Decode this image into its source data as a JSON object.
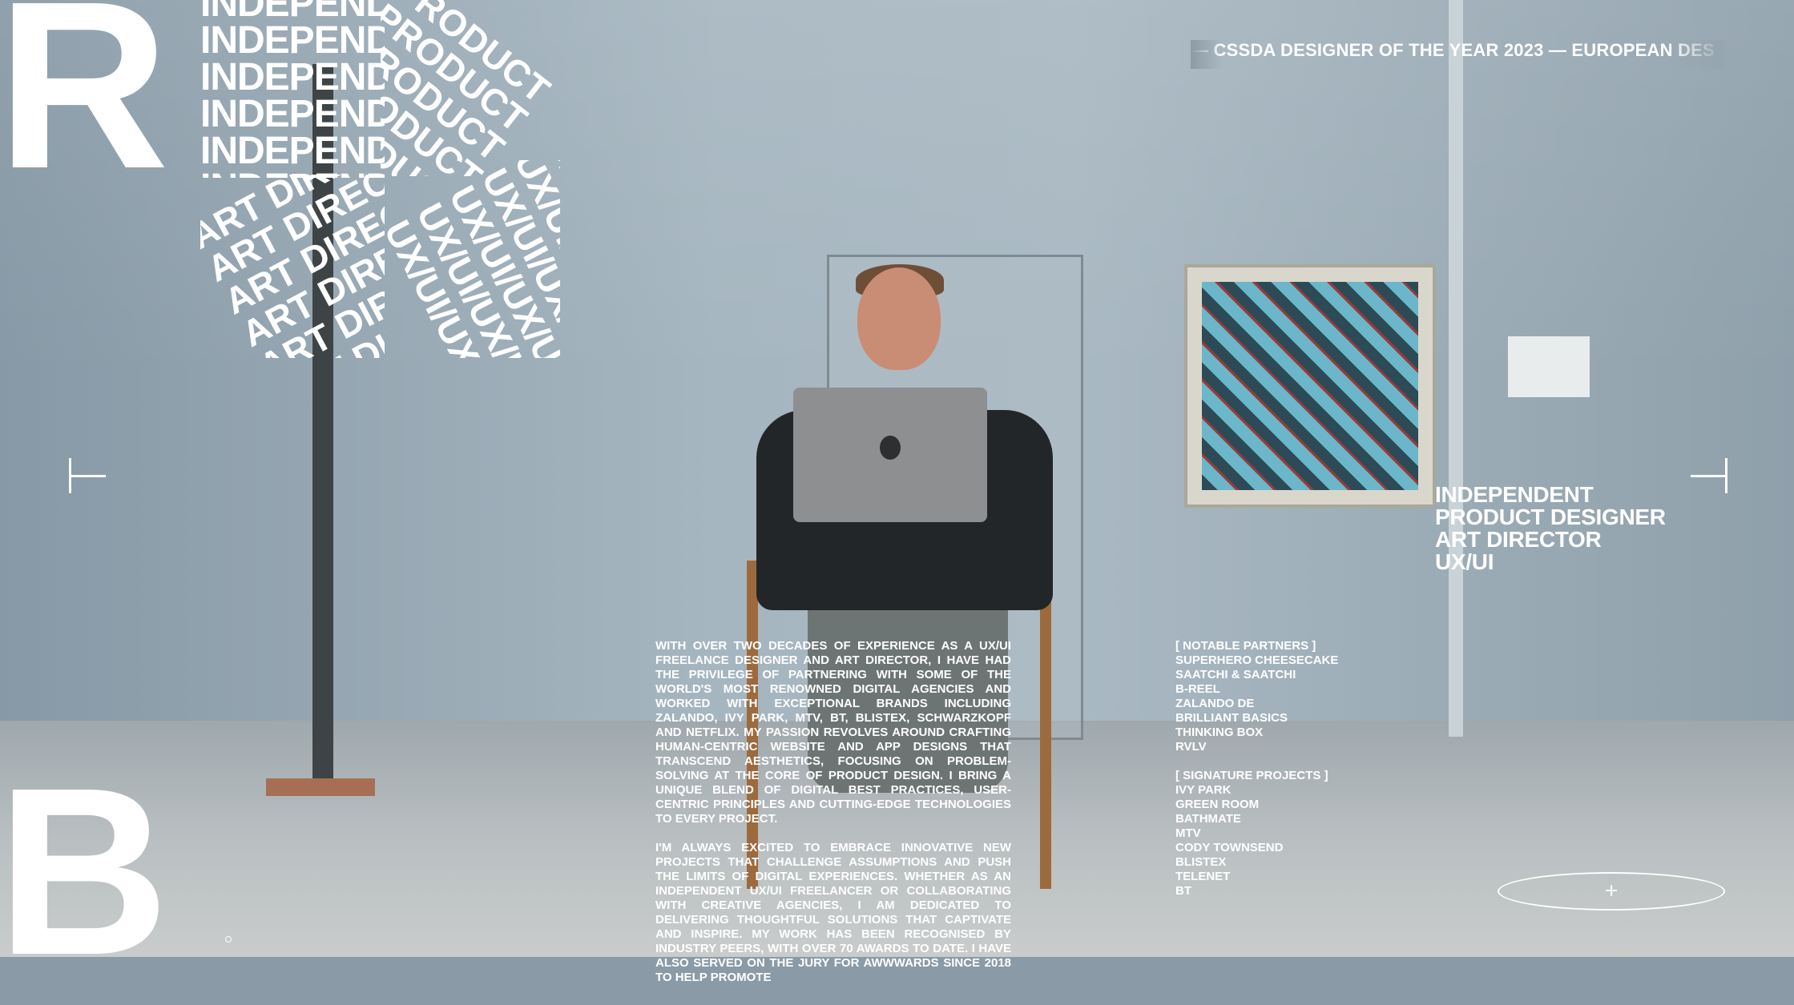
{
  "monogram": {
    "top_letter": "R",
    "bottom_letter": "B"
  },
  "typography_block": {
    "independent_rows": [
      "INDEPENDENT",
      "INDEPENDENT",
      "INDEPENDENT",
      "INDEPENDENT",
      "INDEPENDENT",
      "INDEPENDENT"
    ],
    "product_rows": [
      "PRODUCT",
      "PRODUCT",
      "PRODUCT",
      "PRODUCT",
      "PRODUCT",
      "PRODUCT"
    ],
    "art_director_rows": [
      "ART DIRECTOR",
      "ART DIRECTOR",
      "ART DIRECTOR",
      "ART DIRECTOR",
      "ART DIRECTOR",
      "ART DIRECTOR"
    ],
    "uxui_rows": [
      "UX/UI/UX/UI",
      "UX/UI/UX/UI",
      "UX/UI/UX/UI",
      "UX/UI/UX/UI",
      "UX/UI/UX/UI",
      "UX/UI/UX/UI"
    ]
  },
  "marquee": {
    "text": "— CSSDA DESIGNER OF THE YEAR 2023 — EUROPEAN DES"
  },
  "roles": [
    "INDEPENDENT",
    "PRODUCT DESIGNER",
    "ART DIRECTOR",
    "UX/UI"
  ],
  "bio": {
    "paragraphs": [
      "With over two decades of experience as a UX/UI freelance designer and art director, I have had the privilege of partnering with some of the world's most renowned digital agencies and worked with exceptional brands including Zalando, Ivy Park, MTV, BT, Blistex, Schwarzkopf and Netflix. My passion revolves around crafting human-centric website and app designs that transcend aesthetics, focusing on problem-solving at the core of product design. I bring a unique blend of digital best practices, user-centric principles and cutting-edge technologies to every project.",
      "I'm always excited to embrace innovative new projects that challenge assumptions and push the limits of digital experiences. Whether as an independent UX/UI freelancer or collaborating with creative agencies, I am dedicated to delivering thoughtful solutions that captivate and inspire. My work has been recognised by industry peers, with over 70 awards to date. I have also served on the jury for Awwwards since 2018 to help promote"
    ]
  },
  "notable_partners": {
    "heading": "[ NOTABLE PARTNERS ]",
    "items": [
      "SUPERHERO CHEESECAKE",
      "SAATCHI & SAATCHI",
      "B-REEL",
      "ZALANDO DE",
      "BRILLIANT BASICS",
      "THINKING BOX",
      "RVLV"
    ]
  },
  "signature_projects": {
    "heading": "[ SIGNATURE PROJECTS ]",
    "items": [
      "IVY PARK",
      "GREEN ROOM",
      "BATHMATE",
      "MTV",
      "CODY TOWNSEND",
      "BLISTEX",
      "TELENET",
      "BT"
    ]
  },
  "menu_button": {
    "symbol": "+"
  },
  "colors": {
    "text": "#ffffff",
    "background": "#9aabb6"
  }
}
